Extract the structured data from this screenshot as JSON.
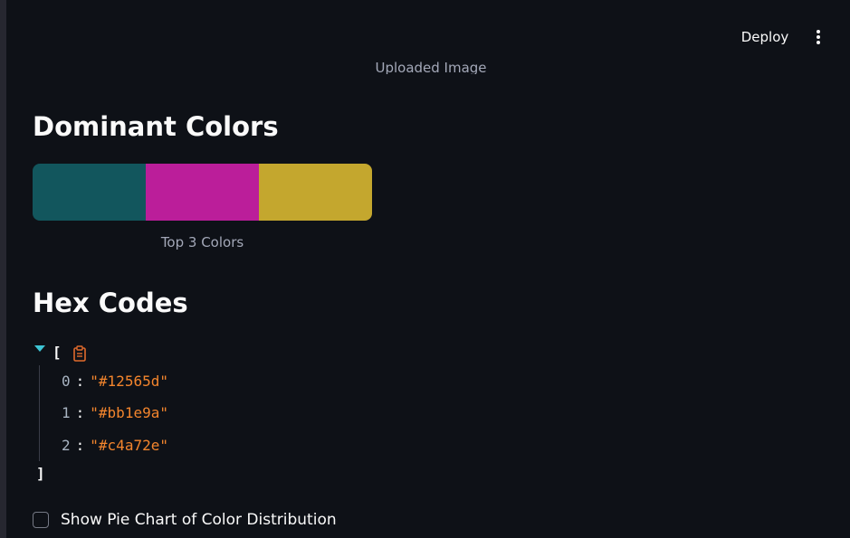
{
  "header": {
    "deploy_label": "Deploy",
    "menu_icon": "vertical-ellipsis-icon"
  },
  "image_caption": "Uploaded Image",
  "dominant": {
    "title": "Dominant Colors",
    "swatches": [
      "#12565d",
      "#bb1e9a",
      "#c4a72e"
    ],
    "caption": "Top 3 Colors"
  },
  "hex": {
    "title": "Hex Codes",
    "open_bracket": "[",
    "close_bracket": "]",
    "copy_icon": "clipboard-icon",
    "expand_icon": "caret-down-icon",
    "items": [
      {
        "index": "0",
        "value": "\"#12565d\""
      },
      {
        "index": "1",
        "value": "\"#bb1e9a\""
      },
      {
        "index": "2",
        "value": "\"#c4a72e\""
      }
    ]
  },
  "checkbox": {
    "label": "Show Pie Chart of Color Distribution",
    "checked": false
  },
  "colors": {
    "background": "#0e1117",
    "text": "#fafafa",
    "json_value": "#f3852d",
    "json_caret": "#3ec5d4"
  }
}
